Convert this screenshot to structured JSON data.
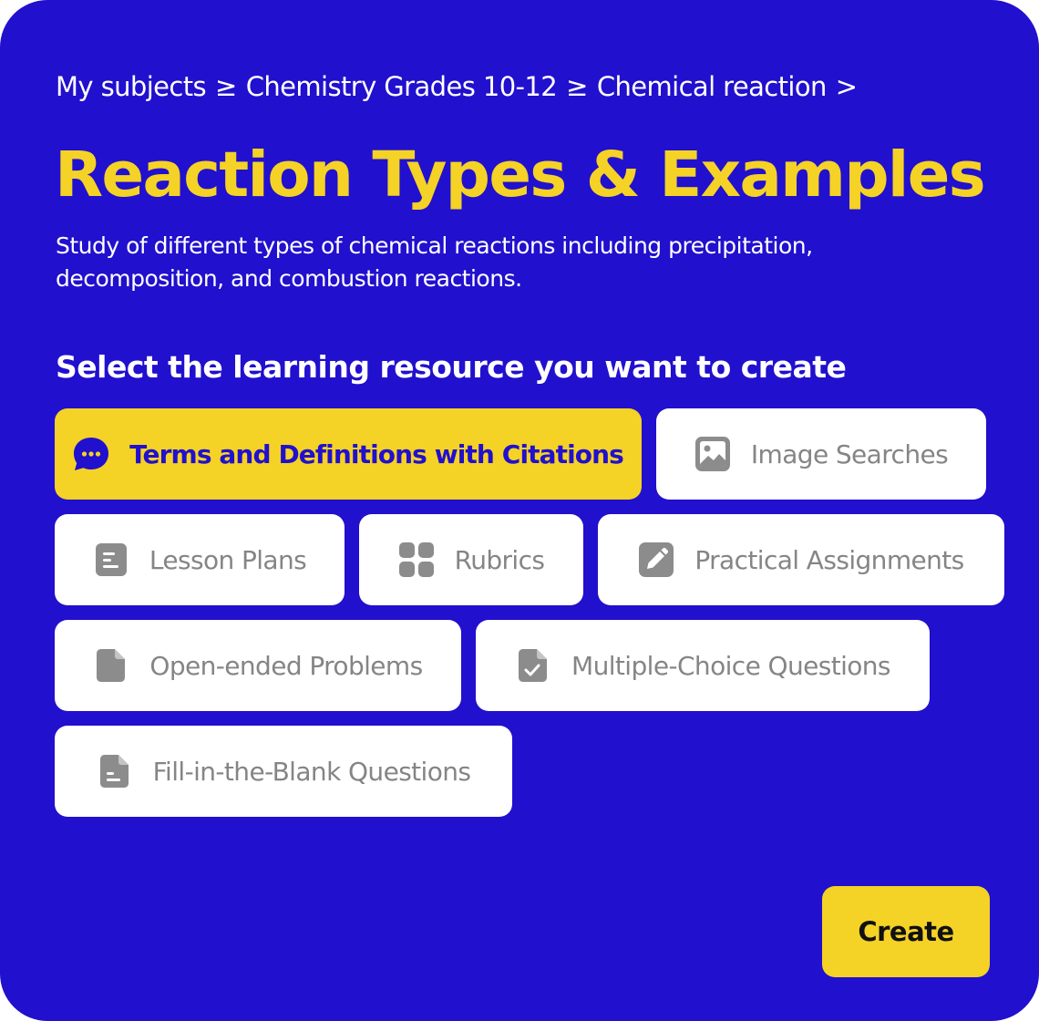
{
  "breadcrumb": {
    "items": [
      "My subjects",
      "Chemistry Grades 10-12",
      "Chemical reaction"
    ],
    "separator": "≥",
    "trailing": ">"
  },
  "title": "Reaction Types & Examples",
  "description": "Study of different types of chemical reactions including precipitation, decomposition, and combustion reactions.",
  "prompt": "Select the learning resource you want to create",
  "options": [
    {
      "label": "Terms and Definitions with Citations",
      "icon": "chat-bubble-icon",
      "selected": true
    },
    {
      "label": "Image Searches",
      "icon": "image-icon",
      "selected": false
    },
    {
      "label": "Lesson Plans",
      "icon": "document-lines-icon",
      "selected": false
    },
    {
      "label": "Rubrics",
      "icon": "grid-icon",
      "selected": false
    },
    {
      "label": "Practical Assignments",
      "icon": "pencil-icon",
      "selected": false
    },
    {
      "label": "Open-ended Problems",
      "icon": "file-icon",
      "selected": false
    },
    {
      "label": "Multiple-Choice Questions",
      "icon": "file-check-icon",
      "selected": false
    },
    {
      "label": "Fill-in-the-Blank Questions",
      "icon": "file-lines-icon",
      "selected": false
    }
  ],
  "create_label": "Create",
  "colors": {
    "background": "#2110CD",
    "accent": "#F5D226",
    "option_background": "#FFFFFF",
    "option_text": "#858585",
    "icon_gray": "#8C8C8C"
  }
}
